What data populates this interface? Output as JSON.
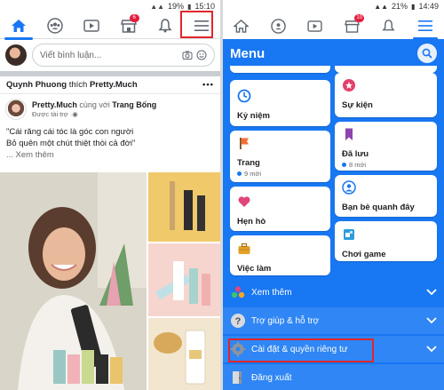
{
  "left": {
    "status": {
      "battery": "19%",
      "time": "15:10"
    },
    "nav": {
      "store_badge": "6"
    },
    "composer": {
      "placeholder": "Viết bình luận..."
    },
    "activity": {
      "actor": "Quynh Phuong",
      "verb": "thích",
      "target": "Pretty.Much"
    },
    "post": {
      "page_name": "Pretty.Much",
      "with_text": "cùng với",
      "partner": "Trang Bống",
      "sponsored": "Được tài trợ",
      "line1": "\"Cái răng cái tóc là góc con người",
      "line2": "Bỏ quên một chút thiệt thòi cả đời\"",
      "see_more": "... Xem thêm"
    }
  },
  "right": {
    "status": {
      "battery": "21%",
      "time": "14:49"
    },
    "nav": {
      "store_badge": "10"
    },
    "menu_title": "Menu",
    "cards": [
      {
        "label": "Kỷ niệm",
        "sub": "",
        "icon": "clock-icon"
      },
      {
        "label": "Sự kiện",
        "sub": "",
        "icon": "event-pin-icon"
      },
      {
        "label": "Trang",
        "sub": "9 mới",
        "icon": "flag-icon"
      },
      {
        "label": "Đã lưu",
        "sub": "8 mới",
        "icon": "bookmark-icon"
      },
      {
        "label": "Hẹn hò",
        "sub": "",
        "icon": "heart-icon"
      },
      {
        "label": "Bạn bè quanh đây",
        "sub": "",
        "icon": "nearby-friends-icon"
      },
      {
        "label": "Việc làm",
        "sub": "",
        "icon": "briefcase-icon"
      },
      {
        "label": "Chơi game",
        "sub": "",
        "icon": "game-icon"
      }
    ],
    "rows": [
      {
        "label": "Xem thêm",
        "icon": "see-more-icon"
      },
      {
        "label": "Trợ giúp & hỗ trợ",
        "icon": "help-icon"
      },
      {
        "label": "Cài đặt & quyền riêng tư",
        "icon": "settings-icon"
      },
      {
        "label": "Đăng xuất",
        "icon": "logout-icon"
      }
    ]
  },
  "colors": {
    "facebook_blue": "#1877f2",
    "highlight_red": "#e0262d"
  }
}
